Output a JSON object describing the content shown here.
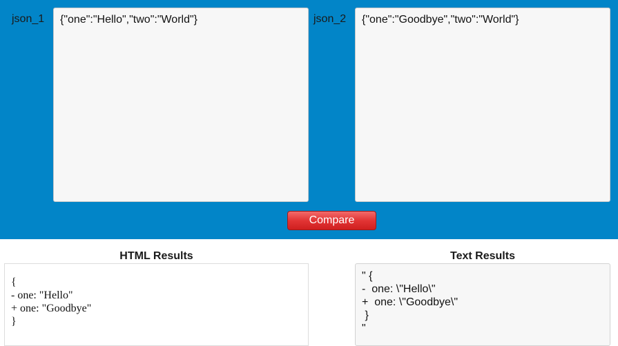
{
  "inputs": {
    "json_1_label": "json_1",
    "json_1_value": "{\"one\":\"Hello\",\"two\":\"World\"}",
    "json_2_label": "json_2",
    "json_2_value": "{\"one\":\"Goodbye\",\"two\":\"World\"}"
  },
  "compare_button_label": "Compare",
  "html_results": {
    "heading": "HTML Results",
    "lines": [
      "{",
      "- one: \"Hello\"",
      "+ one: \"Goodbye\"",
      "}"
    ]
  },
  "text_results": {
    "heading": "Text Results",
    "lines": [
      "\" {",
      "-  one: \\\"Hello\\\"",
      "+  one: \\\"Goodbye\\\"",
      " }",
      "\""
    ]
  },
  "colors": {
    "top_panel_background": "#0285c8",
    "compare_button": "#e23535"
  }
}
